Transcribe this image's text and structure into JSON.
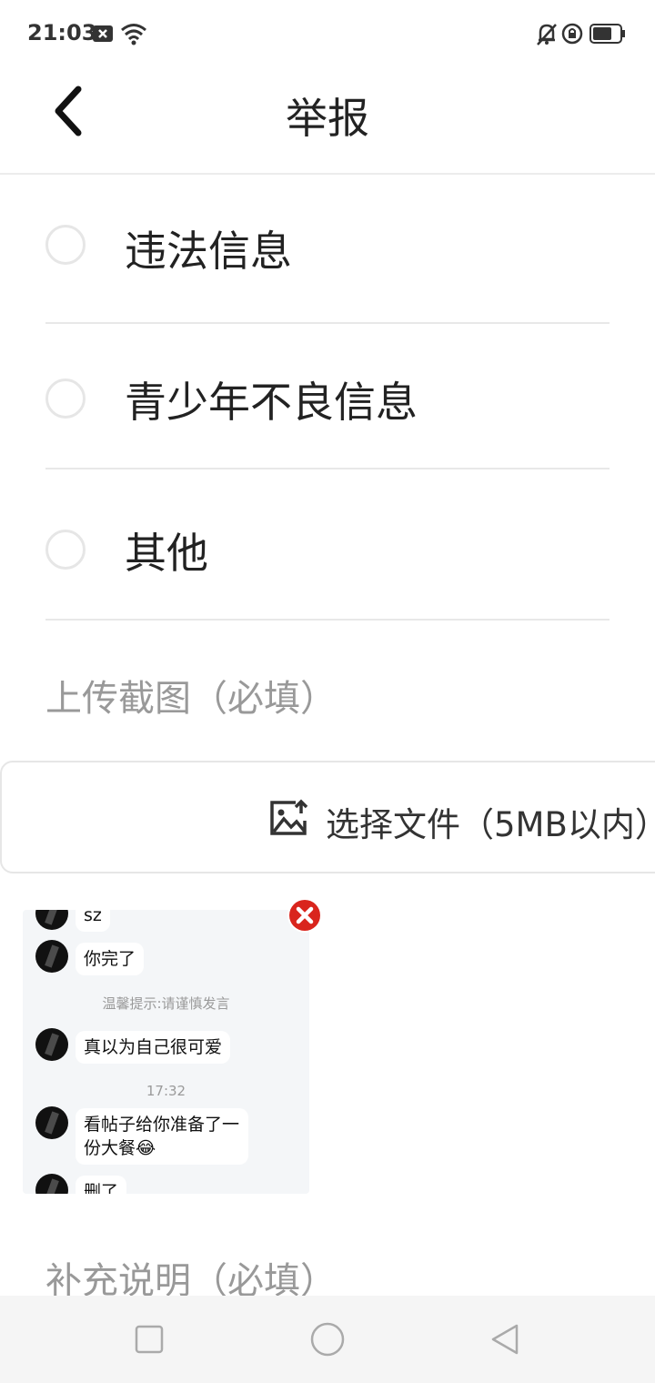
{
  "status_bar": {
    "time": "21:03",
    "icons": [
      "notification-x-icon",
      "wifi-icon",
      "bell-off-icon",
      "rotation-lock-icon",
      "battery-icon"
    ]
  },
  "header": {
    "title": "举报",
    "back_icon": "chevron-left-icon"
  },
  "report_options": [
    {
      "label": "违法信息",
      "selected": false
    },
    {
      "label": "青少年不良信息",
      "selected": false
    },
    {
      "label": "其他",
      "selected": false
    }
  ],
  "upload": {
    "label": "上传截图（必填）",
    "button_text": "选择文件（5MB以内）",
    "button_icon": "image-upload-icon"
  },
  "thumbnail": {
    "remove_icon": "close-circle-icon",
    "messages": [
      {
        "text": "sz"
      },
      {
        "text": "你完了"
      },
      {
        "tip": "温馨提示:请谨慎发言"
      },
      {
        "text": "真以为自己很可爱"
      },
      {
        "time": "17:32"
      },
      {
        "text": "看帖子给你准备了一份大餐😂"
      },
      {
        "text": "删了"
      }
    ]
  },
  "description": {
    "label": "补充说明（必填）"
  },
  "nav_bar": {
    "icons": [
      "recent-apps-icon",
      "home-icon",
      "back-icon"
    ]
  }
}
